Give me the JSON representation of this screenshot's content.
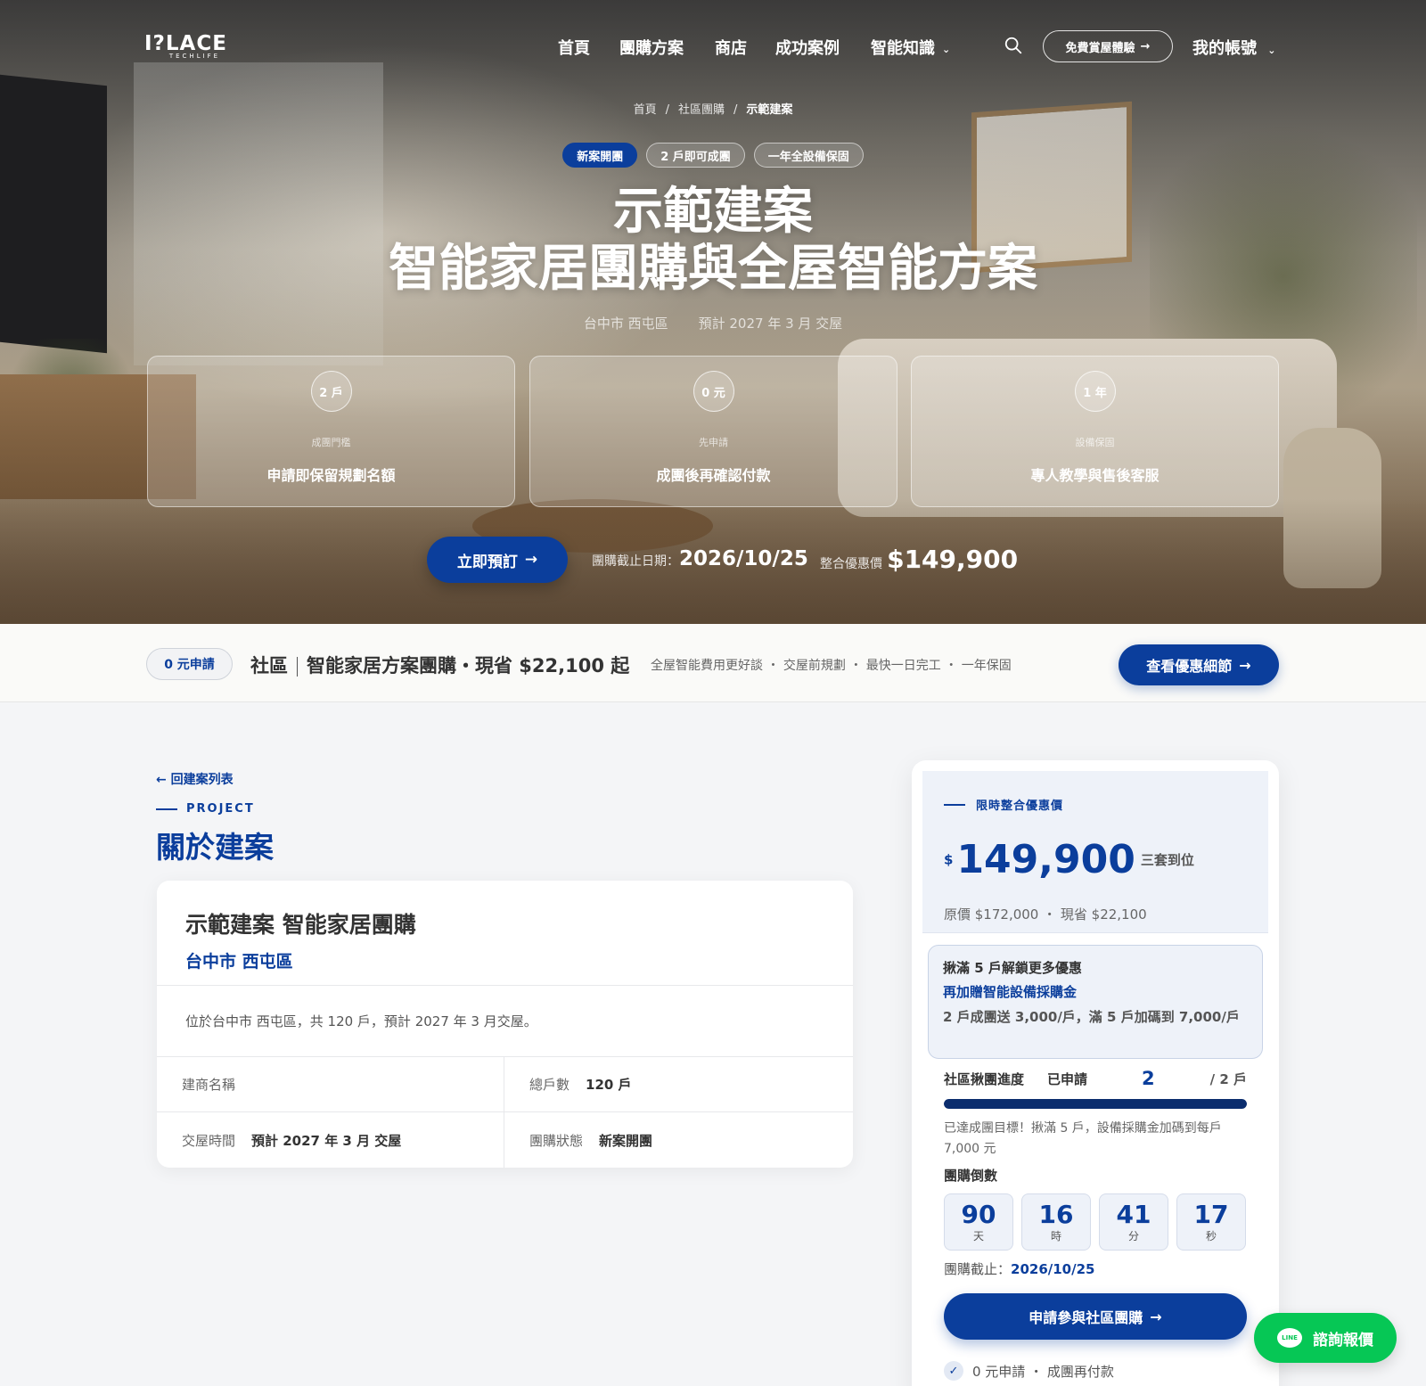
{
  "brand": {
    "logo": "I?LACE",
    "logo_sub": "TECHLIFE"
  },
  "nav": {
    "items": [
      "首頁",
      "團購方案",
      "商店",
      "成功案例",
      "智能知識"
    ],
    "trial_button": "免費賞屋體驗",
    "account": "我的帳號"
  },
  "breadcrumb": {
    "home": "首頁",
    "group": "社區團購",
    "current": "示範建案"
  },
  "hero": {
    "tags": [
      "新案開團",
      "2 戶即可成團",
      "一年全設備保固"
    ],
    "title_line1": "示範建案",
    "title_line2": "智能家居團購與全屋智能方案",
    "location": "台中市 西屯區",
    "delivery": "預計 2027 年 3 月 交屋",
    "features": [
      {
        "badge": "2 戶",
        "label": "成團門檻",
        "desc": "申請即保留規劃名額"
      },
      {
        "badge": "0 元",
        "label": "先申請",
        "desc": "成團後再確認付款"
      },
      {
        "badge": "1 年",
        "label": "設備保固",
        "desc": "專人教學與售後客服"
      }
    ],
    "reserve_button": "立即預訂",
    "deadline_label": "團購截止日期：",
    "deadline_value": "2026/10/25",
    "price_label": "整合優惠價",
    "price_value": "$149,900"
  },
  "promo": {
    "pill": "0 元申請",
    "community": "社區",
    "title": "智能家居方案團購・現省 $22,100 起",
    "subtitle": "全屋智能費用更好談 ・ 交屋前規劃 ・ 最快一日完工 ・ 一年保固",
    "button": "查看優惠細節"
  },
  "project": {
    "back_link": "← 回建案列表",
    "eyebrow": "PROJECT",
    "section_title": "關於建案",
    "name": "示範建案 智能家居團購",
    "location": "台中市 西屯區",
    "description": "位於台中市 西屯區，共 120 戶，預計 2027 年 3 月交屋。",
    "fields": [
      {
        "label": "建商名稱",
        "value": ""
      },
      {
        "label": "總戶數",
        "value": "120 戶"
      },
      {
        "label": "交屋時間",
        "value": "預計 2027 年 3 月 交屋"
      },
      {
        "label": "團購狀態",
        "value": "新案開團"
      }
    ]
  },
  "price_card": {
    "eyebrow": "限時整合優惠價",
    "currency": "$",
    "price": "149,900",
    "unit": "三套到位",
    "original": "原價 $172,000 ・ 現省 $22,100",
    "unlock_title": "揪滿 5 戶解鎖更多優惠",
    "unlock_highlight": "再加贈智能設備採購金",
    "unlock_detail": "2 戶成團送 3,000/戶，滿 5 戶加碼到 7,000/戶",
    "progress_label": "社區揪團進度",
    "applied_label": "已申請",
    "applied_count": "2",
    "goal": "/ 2 戶",
    "progress_fraction": 1.0,
    "progress_note": "已達成團目標！揪滿 5 戶，設備採購金加碼到每戶 7,000 元",
    "countdown_label": "團購倒數",
    "countdown": [
      {
        "value": "90",
        "unit": "天"
      },
      {
        "value": "16",
        "unit": "時"
      },
      {
        "value": "41",
        "unit": "分"
      },
      {
        "value": "17",
        "unit": "秒"
      }
    ],
    "deadline_label": "團購截止：",
    "deadline_value": "2026/10/25",
    "apply_button": "申請參與社區團購",
    "assurance": "0 元申請 ・ 成團再付款"
  },
  "line_chat": {
    "icon": "LINE",
    "label": "諮詢報價"
  },
  "colors": {
    "primary": "#0b3e9c",
    "line_green": "#06c755"
  }
}
